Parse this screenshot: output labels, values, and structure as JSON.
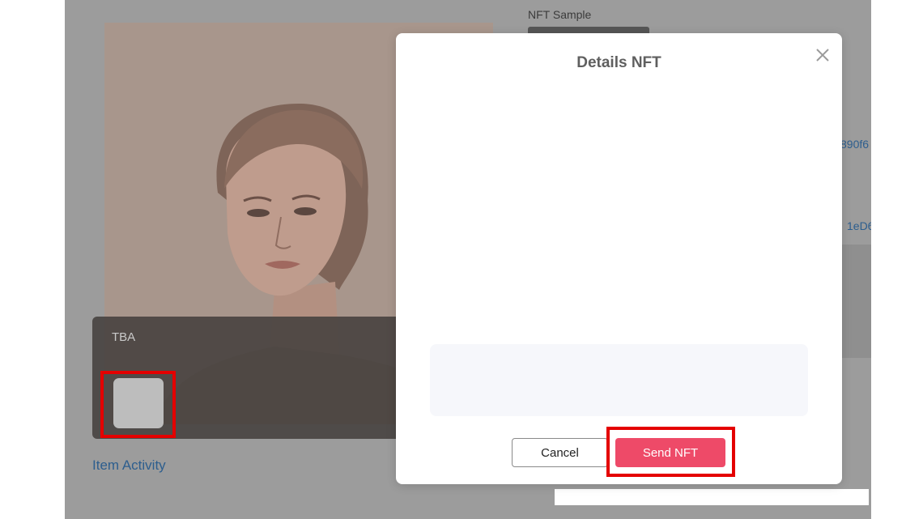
{
  "background": {
    "nft_sample_label": "NFT Sample",
    "tba_label": "TBA",
    "item_activity_link": "Item Activity",
    "address_fragment_1": "890f6",
    "address_fragment_2": "1eD6"
  },
  "modal": {
    "title": "Details NFT",
    "close_icon": "close-icon",
    "cancel_label": "Cancel",
    "send_label": "Send NFT"
  },
  "colors": {
    "send_button": "#ee4a68",
    "highlight": "#e40000",
    "link": "#2d5e8e",
    "overlay": "#9c9c9c"
  }
}
